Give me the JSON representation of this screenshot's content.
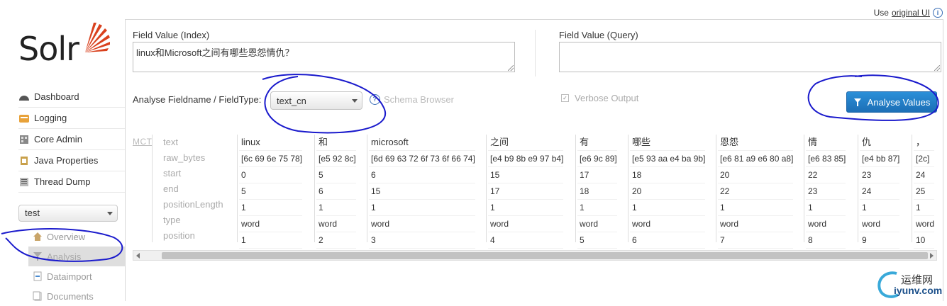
{
  "top_link": {
    "prefix": "Use",
    "link": "original UI"
  },
  "logo": {
    "text": "Solr"
  },
  "nav": [
    "Dashboard",
    "Logging",
    "Core Admin",
    "Java Properties",
    "Thread Dump"
  ],
  "core_selector": {
    "value": "test"
  },
  "core_menu": [
    "Overview",
    "Analysis",
    "Dataimport",
    "Documents"
  ],
  "form": {
    "index_label": "Field Value (Index)",
    "index_value": "linux和Microsoft之间有哪些恩怨情仇？",
    "query_label": "Field Value (Query)",
    "query_value": "",
    "fieldtype_label": "Analyse Fieldname / FieldType:",
    "fieldtype_value": "text_cn",
    "schema_browser": "Schema Browser",
    "verbose_label": "Verbose Output",
    "analyse_button": "Analyse Values"
  },
  "analysis": {
    "tokenizer": "MCT",
    "row_labels": [
      "text",
      "raw_bytes",
      "start",
      "end",
      "positionLength",
      "type",
      "position"
    ],
    "tokens": [
      {
        "text": "linux",
        "raw_bytes": "[6c 69 6e 75 78]",
        "start": "0",
        "end": "5",
        "positionLength": "1",
        "type": "word",
        "position": "1"
      },
      {
        "text": "和",
        "raw_bytes": "[e5 92 8c]",
        "start": "5",
        "end": "6",
        "positionLength": "1",
        "type": "word",
        "position": "2"
      },
      {
        "text": "microsoft",
        "raw_bytes": "[6d 69 63 72 6f 73 6f 66 74]",
        "start": "6",
        "end": "15",
        "positionLength": "1",
        "type": "word",
        "position": "3"
      },
      {
        "text": "之间",
        "raw_bytes": "[e4 b9 8b e9 97 b4]",
        "start": "15",
        "end": "17",
        "positionLength": "1",
        "type": "word",
        "position": "4"
      },
      {
        "text": "有",
        "raw_bytes": "[e6 9c 89]",
        "start": "17",
        "end": "18",
        "positionLength": "1",
        "type": "word",
        "position": "5"
      },
      {
        "text": "哪些",
        "raw_bytes": "[e5 93 aa e4 ba 9b]",
        "start": "18",
        "end": "20",
        "positionLength": "1",
        "type": "word",
        "position": "6"
      },
      {
        "text": "恩怨",
        "raw_bytes": "[e6 81 a9 e6 80 a8]",
        "start": "20",
        "end": "22",
        "positionLength": "1",
        "type": "word",
        "position": "7"
      },
      {
        "text": "情",
        "raw_bytes": "[e6 83 85]",
        "start": "22",
        "end": "23",
        "positionLength": "1",
        "type": "word",
        "position": "8"
      },
      {
        "text": "仇",
        "raw_bytes": "[e4 bb 87]",
        "start": "23",
        "end": "24",
        "positionLength": "1",
        "type": "word",
        "position": "9"
      },
      {
        "text": "，",
        "raw_bytes": "[2c]",
        "start": "24",
        "end": "25",
        "positionLength": "1",
        "type": "word",
        "position": "10"
      }
    ]
  },
  "watermark": {
    "line1": "运维网",
    "line2": "iyunv.com"
  },
  "colors": {
    "accent": "#1c6fb6",
    "annotation": "#1a1acc"
  }
}
